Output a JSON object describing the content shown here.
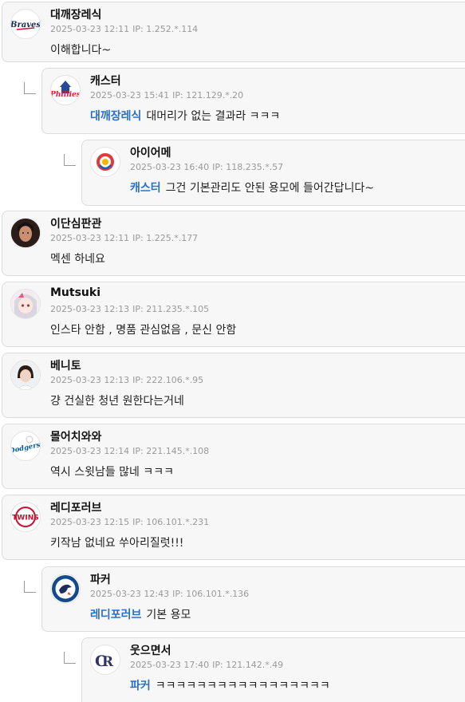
{
  "colors": {
    "mention": "#2a6fc9",
    "meta": "#9a9a9a",
    "card_bg": "#f7f7f8"
  },
  "comments": [
    {
      "name": "대깨장레식",
      "date": "2025-03-23 12:11",
      "ip": "IP: 1.252.*.114",
      "text": "이해합니다~",
      "avatar": "braves-logo"
    },
    {
      "name": "캐스터",
      "date": "2025-03-23 15:41",
      "ip": "IP: 121.129.*.20",
      "mention": "대깨장레식",
      "text": "대머리가 없는 결과라 ㅋㅋㅋ",
      "avatar": "phillies-logo"
    },
    {
      "name": "아이어메",
      "date": "2025-03-23 16:40",
      "ip": "IP: 118.235.*.57",
      "mention": "캐스터",
      "text": "그건 기본관리도 안된 용모에 들어간답니다~",
      "avatar": "kiwoom-logo"
    },
    {
      "name": "이단심판관",
      "date": "2025-03-23 12:11",
      "ip": "IP: 1.225.*.177",
      "text": "멕센 하네요",
      "avatar": "portrait-avatar"
    },
    {
      "name": "Mutsuki",
      "date": "2025-03-23 12:13",
      "ip": "IP: 211.235.*.105",
      "text": "인스타 안함 , 명품 관심없음 , 문신 안함",
      "avatar": "anime-girl-avatar"
    },
    {
      "name": "베니토",
      "date": "2025-03-23 12:13",
      "ip": "IP: 222.106.*.95",
      "text": "걍 건실한 청년 원한다는거네",
      "avatar": "girl-photo-avatar"
    },
    {
      "name": "몰어치와와",
      "date": "2025-03-23 12:14",
      "ip": "IP: 221.145.*.108",
      "text": "역시 스윗남들 많네 ㅋㅋㅋ",
      "avatar": "dodgers-logo"
    },
    {
      "name": "레디포러브",
      "date": "2025-03-23 12:15",
      "ip": "IP: 106.101.*.231",
      "text": "키작남 없네요 쑤아리질럿!!!",
      "avatar": "twins-logo"
    },
    {
      "name": "파커",
      "date": "2025-03-23 12:43",
      "ip": "IP: 106.101.*.136",
      "mention": "레디포러브",
      "text": "기본 용모",
      "avatar": "bluejays-logo"
    },
    {
      "name": "웃으면서",
      "date": "2025-03-23 17:40",
      "ip": "IP: 121.142.*.49",
      "mention": "파커",
      "text": "ㅋㅋㅋㅋㅋㅋㅋㅋㅋㅋㅋㅋㅋㅋㅋㅋㅋ",
      "avatar": "rockies-logo"
    }
  ]
}
